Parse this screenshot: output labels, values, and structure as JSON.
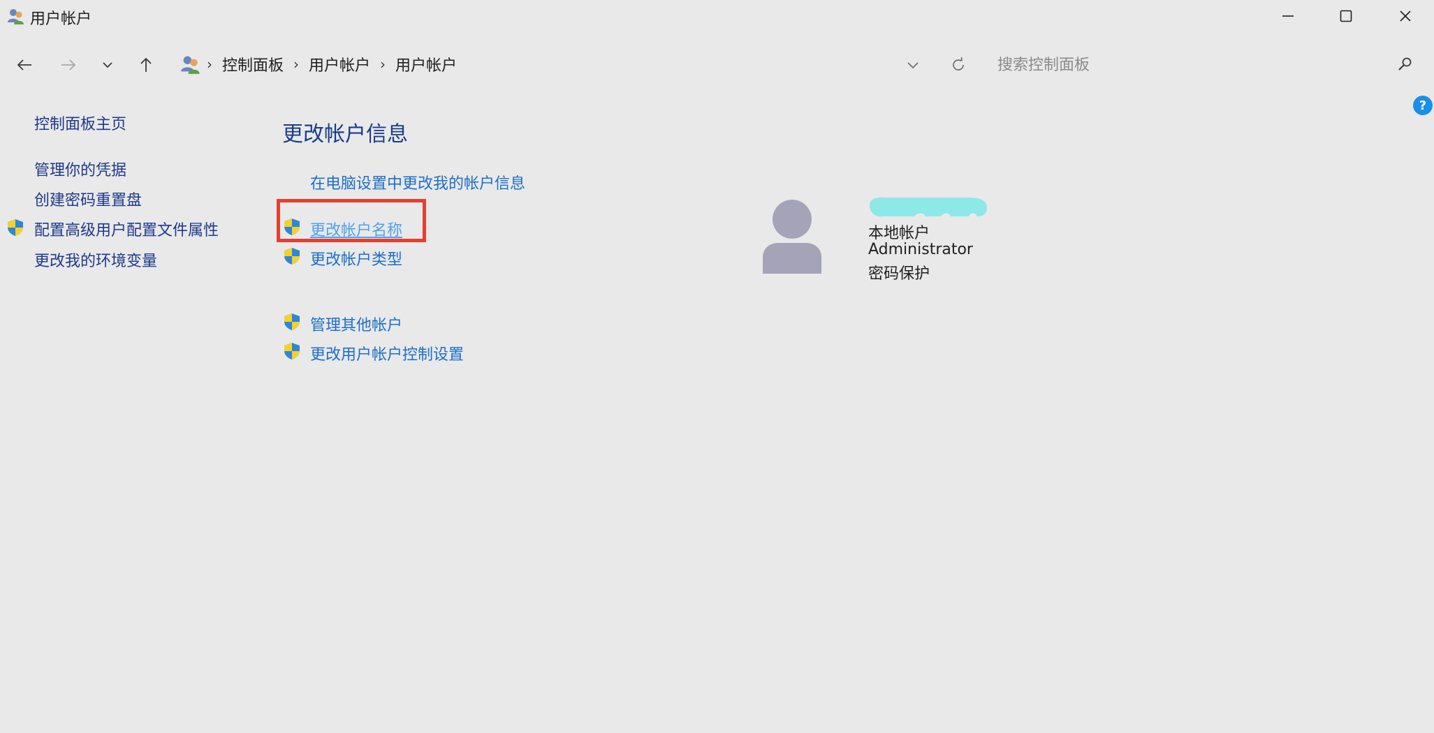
{
  "window": {
    "title": "用户帐户"
  },
  "nav": {
    "breadcrumbs": [
      "控制面板",
      "用户帐户",
      "用户帐户"
    ],
    "separator": "›",
    "search_placeholder": "搜索控制面板"
  },
  "help": {
    "label": "?"
  },
  "sidebar": {
    "items": [
      {
        "label": "控制面板主页",
        "shield": false
      },
      {
        "label": "管理你的凭据",
        "shield": false
      },
      {
        "label": "创建密码重置盘",
        "shield": false
      },
      {
        "label": "配置高级用户配置文件属性",
        "shield": true
      },
      {
        "label": "更改我的环境变量",
        "shield": false
      }
    ]
  },
  "main": {
    "title": "更改帐户信息",
    "tasks": [
      {
        "label": "在电脑设置中更改我的帐户信息",
        "shield": false
      },
      {
        "label": "更改帐户名称",
        "shield": true,
        "highlighted": true
      },
      {
        "label": "更改帐户类型",
        "shield": true
      },
      {
        "label": "管理其他帐户",
        "shield": true
      },
      {
        "label": "更改用户帐户控制设置",
        "shield": true
      }
    ]
  },
  "account": {
    "type": "本地帐户",
    "role": "Administrator",
    "protection": "密码保护"
  },
  "colors": {
    "background": "#e9e9e9",
    "sidebar_link": "#1d3a8a",
    "task_link": "#1c6fc9",
    "highlight": "#e4402f",
    "help": "#1a8fe8",
    "redaction": "#8ee8e8"
  }
}
